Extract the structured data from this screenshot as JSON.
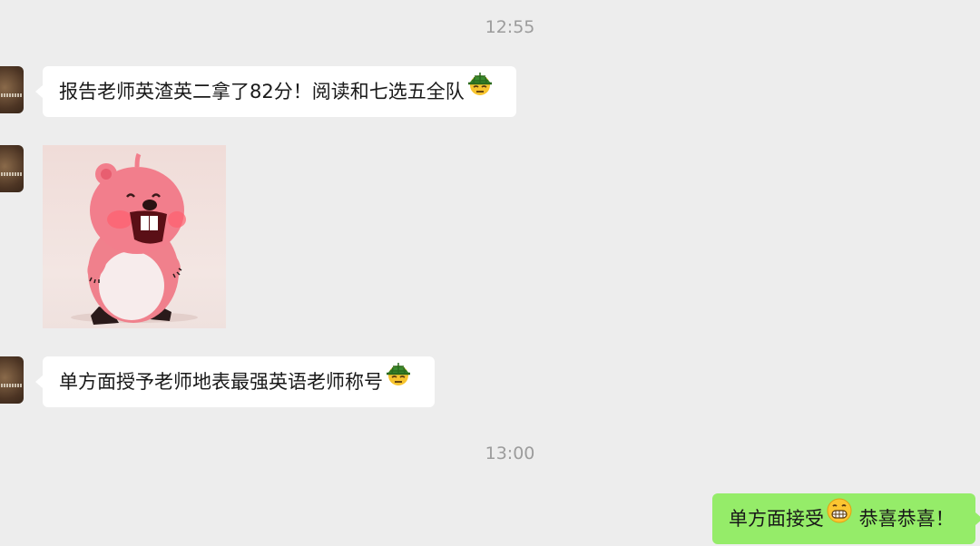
{
  "chat": {
    "timestamps": [
      "12:55",
      "13:00"
    ],
    "messages": [
      {
        "sender": "other",
        "type": "text",
        "text": "报告老师英渣英二拿了82分！阅读和七选五全队",
        "emoji": "turtle-helmet-emoji"
      },
      {
        "sender": "other",
        "type": "sticker",
        "sticker": "pink-beaver-loopy-sticker"
      },
      {
        "sender": "other",
        "type": "text",
        "text": "单方面授予老师地表最强英语老师称号",
        "emoji": "turtle-helmet-emoji"
      },
      {
        "sender": "me",
        "type": "text",
        "text_before": "单方面接受",
        "emoji": "grinning-face-emoji",
        "text_after": " 恭喜恭喜！"
      }
    ]
  },
  "colors": {
    "background": "#ededed",
    "incoming_bubble": "#ffffff",
    "outgoing_bubble": "#95ec69",
    "timestamp": "#9c9c9c"
  }
}
